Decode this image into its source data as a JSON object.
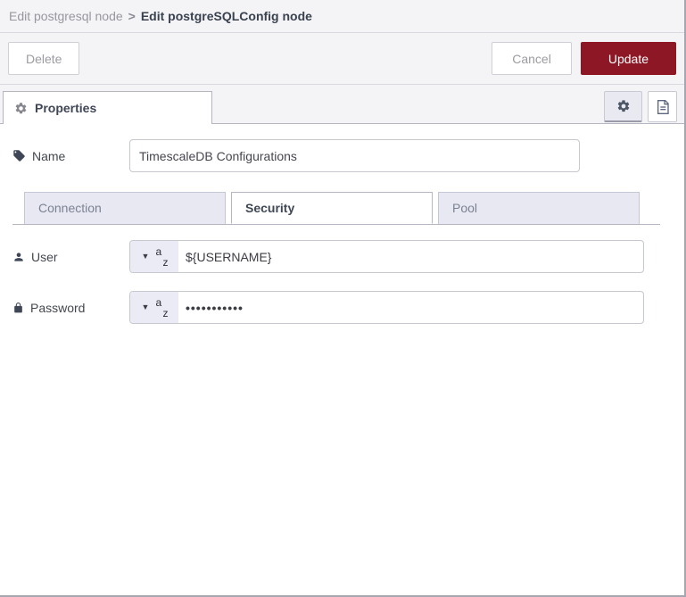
{
  "breadcrumb": {
    "parent": "Edit postgresql node",
    "separator": ">",
    "current": "Edit postgreSQLConfig node"
  },
  "toolbar": {
    "delete_label": "Delete",
    "cancel_label": "Cancel",
    "update_label": "Update"
  },
  "panel": {
    "properties_tab_label": "Properties",
    "icon_buttons": [
      "gear-icon",
      "document-icon"
    ]
  },
  "form": {
    "name": {
      "label": "Name",
      "value": "TimescaleDB Configurations"
    },
    "tabs": [
      {
        "label": "Connection",
        "active": false
      },
      {
        "label": "Security",
        "active": true
      },
      {
        "label": "Pool",
        "active": false
      }
    ],
    "user": {
      "label": "User",
      "value": "${USERNAME}",
      "type": "string"
    },
    "password": {
      "label": "Password",
      "value": "•••••••••••",
      "type": "string"
    }
  },
  "icons": {
    "caret_down": "▼",
    "type_letter_a": "a",
    "type_letter_z": "z"
  },
  "colors": {
    "update_button": "#8e1725",
    "header_bg": "#f4f4f7",
    "inactive_tab_bg": "#e7e8f1",
    "active_text": "#3f4656",
    "muted_text": "#97979e"
  }
}
